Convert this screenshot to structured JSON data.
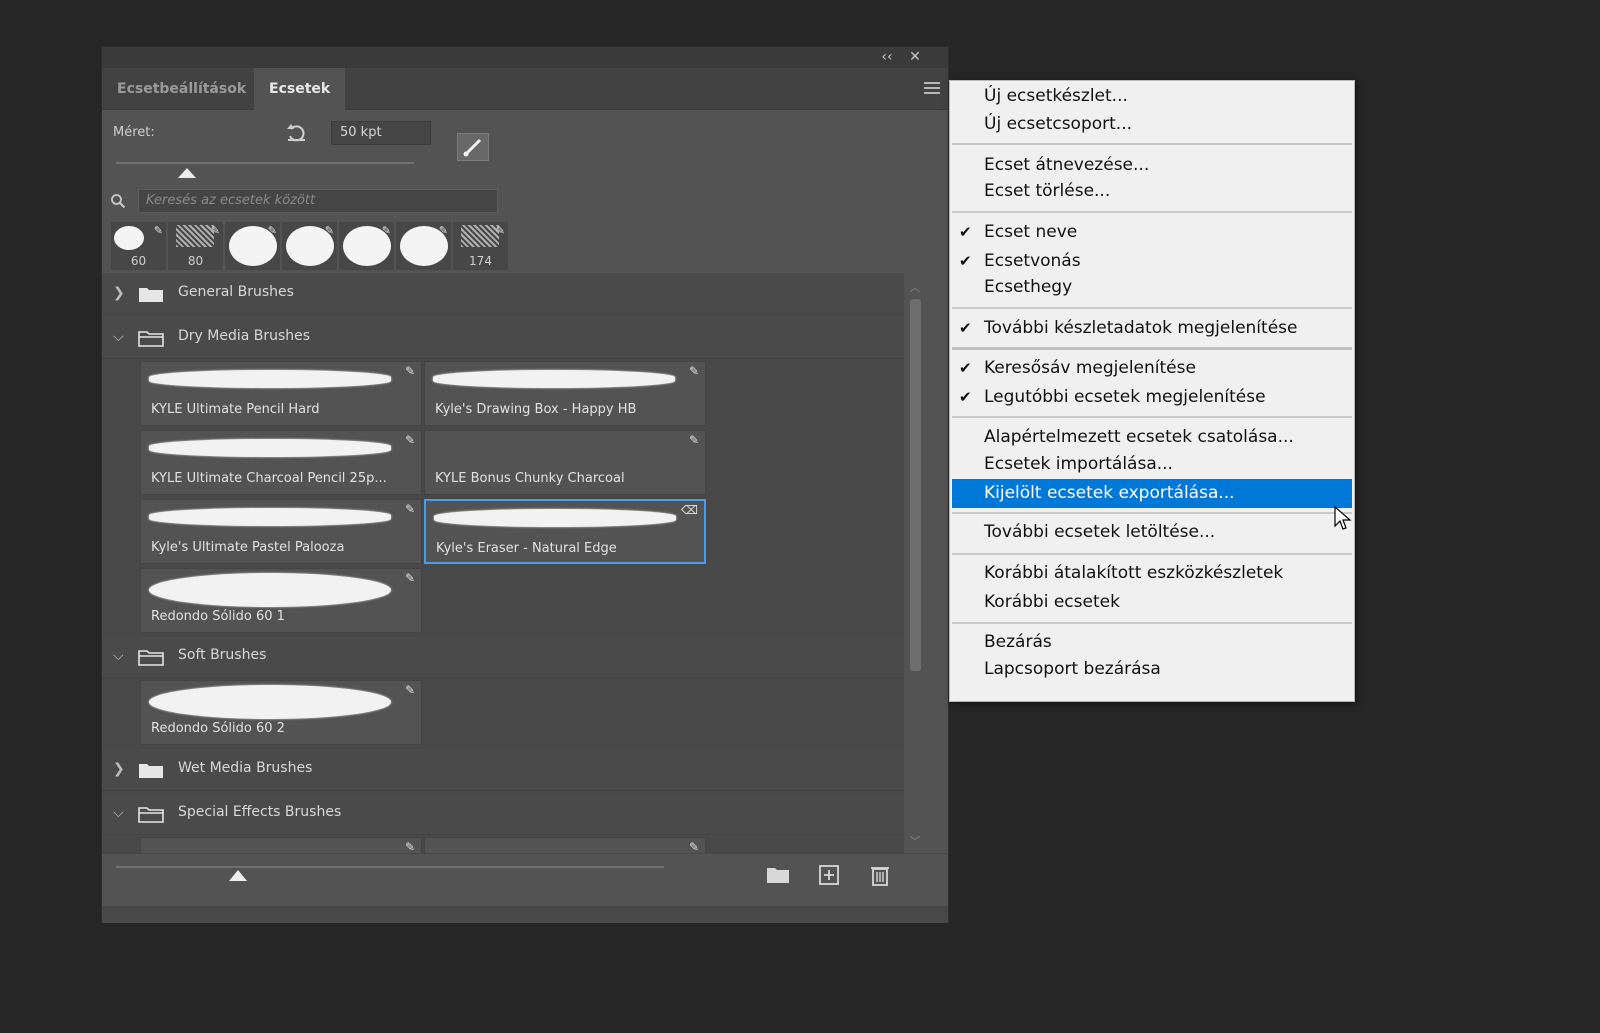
{
  "panel": {
    "collapse_glyph": "‹‹",
    "close_glyph": "✕",
    "tabs": [
      {
        "label": "Ecsetbeállítások",
        "active": false
      },
      {
        "label": "Ecsetek",
        "active": true
      }
    ],
    "size_label": "Méret:",
    "size_value": "50 kpt",
    "search_placeholder": "Keresés az ecsetek között",
    "recent_brushes": [
      {
        "size": "60",
        "kind": "small-round"
      },
      {
        "size": "80",
        "kind": "texture"
      },
      {
        "size": "",
        "kind": "round"
      },
      {
        "size": "",
        "kind": "round"
      },
      {
        "size": "",
        "kind": "round"
      },
      {
        "size": "",
        "kind": "round"
      },
      {
        "size": "174",
        "kind": "texture"
      }
    ],
    "groups": {
      "general": {
        "name": "General Brushes",
        "expanded": false
      },
      "dry": {
        "name": "Dry Media Brushes",
        "expanded": true
      },
      "soft": {
        "name": "Soft Brushes",
        "expanded": true
      },
      "wet": {
        "name": "Wet Media Brushes",
        "expanded": false
      },
      "special": {
        "name": "Special Effects Brushes",
        "expanded": true
      }
    },
    "dry_brushes": [
      {
        "name": "KYLE Ultimate Pencil Hard"
      },
      {
        "name": "Kyle's Drawing Box - Happy HB"
      },
      {
        "name": "KYLE Ultimate Charcoal Pencil 25p..."
      },
      {
        "name": "KYLE Bonus Chunky Charcoal"
      },
      {
        "name": "Kyle's Ultimate Pastel Palooza"
      },
      {
        "name": "Kyle's Eraser - Natural Edge",
        "selected": true
      },
      {
        "name": "Redondo Sólido 60 1"
      }
    ],
    "soft_brushes": [
      {
        "name": "Redondo Sólido 60 2"
      }
    ],
    "size_slider_fraction": 0.25,
    "preview_slider_fraction": 0.23
  },
  "context_menu": {
    "items": {
      "new_preset": "Új ecsetkészlet...",
      "new_group": "Új ecsetcsoport...",
      "rename": "Ecset átnevezése...",
      "delete": "Ecset törlése...",
      "brush_name": "Ecset neve",
      "brush_stroke": "Ecsetvonás",
      "brush_tip": "Ecsethegy",
      "more_info": "További készletadatok megjelenítése",
      "show_search": "Keresősáv megjelenítése",
      "show_recent": "Legutóbbi ecsetek megjelenítése",
      "append_default": "Alapértelmezett ecsetek csatolása...",
      "import": "Ecsetek importálása...",
      "export": "Kijelölt ecsetek exportálása...",
      "get_more": "További ecsetek letöltése...",
      "legacy_tool_presets": "Korábbi átalakított eszközkészletek",
      "legacy_brushes": "Korábbi ecsetek",
      "close": "Bezárás",
      "close_group": "Lapcsoport bezárása"
    },
    "checked": [
      "brush_name",
      "brush_stroke",
      "more_info",
      "show_search",
      "show_recent"
    ],
    "highlighted": "export",
    "check_glyph": "✔"
  },
  "colors": {
    "highlight": "#0078d7",
    "selection_border": "#4a9be8",
    "panel_bg": "#535353",
    "app_bg": "#262626"
  }
}
